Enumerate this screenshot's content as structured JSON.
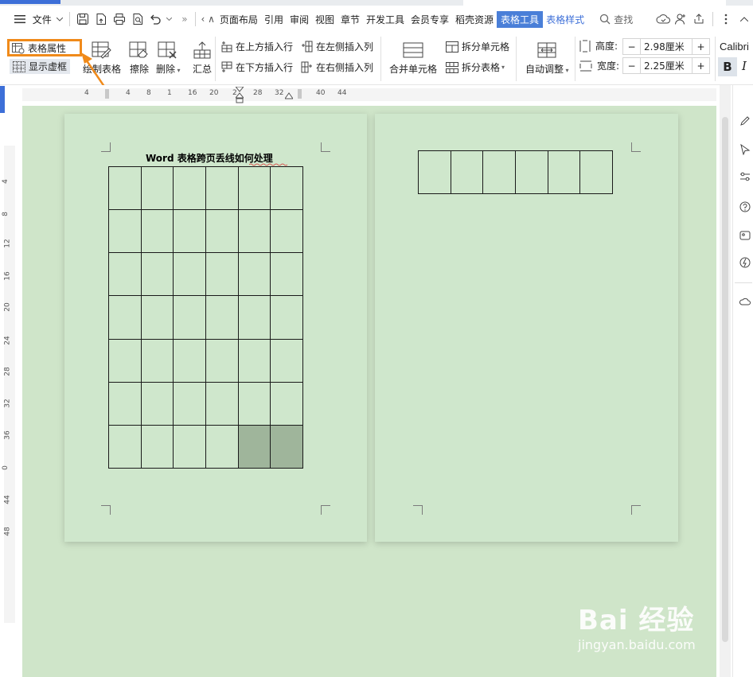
{
  "menubar": {
    "menu_label": "文件",
    "more_label": "»",
    "tabs": [
      "页面布局",
      "引用",
      "审阅",
      "视图",
      "章节",
      "开发工具",
      "会员专享",
      "稻壳资源"
    ],
    "active_tab": "表格工具",
    "style_tab": "表格样式",
    "search_label": "查找"
  },
  "ribbon": {
    "table_props": "表格属性",
    "show_gridlines": "显示虚框",
    "draw_table": "绘制表格",
    "erase": "擦除",
    "delete": "删除",
    "summary": "汇总",
    "insert_row_above": "在上方插入行",
    "insert_row_below": "在下方插入行",
    "insert_col_left": "在左侧插入列",
    "insert_col_right": "在右侧插入列",
    "merge_cells": "合并单元格",
    "split_cells": "拆分单元格",
    "split_table": "拆分表格",
    "auto_adjust": "自动调整",
    "height_label": "高度:",
    "height_value": "2.98厘米",
    "width_label": "宽度:",
    "width_value": "2.25厘米",
    "font_name": "Calibri",
    "bold": "B",
    "italic": "I",
    "minus": "−",
    "plus": "+"
  },
  "ruler": {
    "top_numbers": [
      "4",
      "4",
      "8",
      "1",
      "16",
      "20",
      "2",
      "28",
      "32",
      "40",
      "44"
    ],
    "left_numbers": [
      "4",
      "8",
      "12",
      "16",
      "20",
      "24",
      "28",
      "32",
      "36",
      "0",
      "44",
      "48"
    ]
  },
  "document": {
    "title": "Word 表格跨页丢线如何处理",
    "page1_table": {
      "rows": 7,
      "cols": 6,
      "shaded_cells": [
        [
          6,
          4
        ],
        [
          6,
          5
        ]
      ]
    },
    "page2_table": {
      "rows": 1,
      "cols": 6
    }
  },
  "watermark": {
    "brand": "Bai 经验",
    "url": "jingyan.baidu.com"
  },
  "colors": {
    "accent": "#4a7fd8",
    "highlight": "#f08a1a",
    "canvas": "#cfe5c9",
    "shaded_cell": "#9fb59b"
  }
}
